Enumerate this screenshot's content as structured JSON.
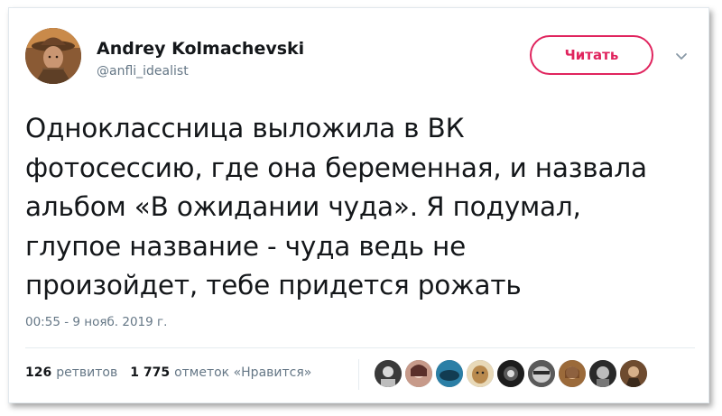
{
  "author": {
    "display_name": "Andrey Kolmachevski",
    "handle": "@anfli_idealist"
  },
  "follow_button": {
    "label": "Читать",
    "color": "#e0245e"
  },
  "tweet": {
    "text": "Одноклассница выложила в ВК\nфотосессию, где она беременная, и назвала\nальбом «В ожидании чуда». Я подумал,\nглупое название - чуда ведь не\nпроизойдет, тебе придется рожать",
    "timestamp": "00:55 - 9 нояб. 2019 г."
  },
  "stats": {
    "retweets_count": "126",
    "retweets_label": "ретвитов",
    "likes_count": "1 775",
    "likes_label": "отметок «Нравится»"
  },
  "likers": [
    {
      "icon": "liker-avatar-1",
      "color": "#3a3a3a"
    },
    {
      "icon": "liker-avatar-2",
      "color": "#c79a8a"
    },
    {
      "icon": "liker-avatar-3",
      "color": "#2b7fa6"
    },
    {
      "icon": "liker-avatar-4",
      "color": "#b98a4e"
    },
    {
      "icon": "liker-avatar-5",
      "color": "#1d1d1d"
    },
    {
      "icon": "liker-avatar-6",
      "color": "#5a5a5a"
    },
    {
      "icon": "liker-avatar-7",
      "color": "#9b6a3a"
    },
    {
      "icon": "liker-avatar-8",
      "color": "#2a2a2a"
    },
    {
      "icon": "liker-avatar-9",
      "color": "#6e4b2f"
    }
  ]
}
